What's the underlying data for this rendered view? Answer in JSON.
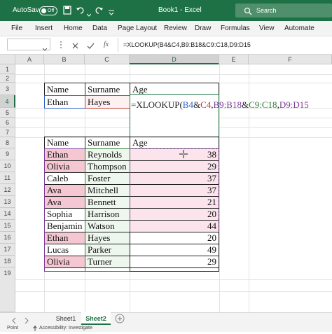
{
  "titlebar": {
    "autosave_label": "AutoSave",
    "autosave_state": "Off",
    "doc_title": "Book1 - Excel",
    "search_placeholder": "Search",
    "icons": [
      "save-icon",
      "undo-icon",
      "redo-icon",
      "customize-icon"
    ]
  },
  "ribbon": {
    "tabs": [
      "File",
      "Insert",
      "Home",
      "Data",
      "Page Layout",
      "Review",
      "Draw",
      "Formulas",
      "View",
      "Automate"
    ]
  },
  "formula_bar": {
    "name_box": "",
    "fx": "fx",
    "formula": "=XLOOKUP(B4&C4,B9:B18&C9:C18,D9:D15"
  },
  "grid": {
    "columns": [
      "A",
      "B",
      "C",
      "D",
      "E",
      "F"
    ],
    "rows": [
      "1",
      "2",
      "3",
      "4",
      "5",
      "6",
      "7",
      "8",
      "9",
      "10",
      "11",
      "12",
      "13",
      "14",
      "15",
      "16",
      "17",
      "18",
      "19"
    ]
  },
  "lookup_table": {
    "headers": [
      "Name",
      "Surname",
      "Age"
    ],
    "name": "Ethan",
    "surname": "Hayes",
    "formula_parts": [
      "=XLOOKUP(",
      "B4",
      "&",
      "C4",
      ",",
      "B9:B18",
      "&",
      "C9:C18",
      ",",
      "D9:",
      "D15"
    ]
  },
  "data_table": {
    "headers": [
      "Name",
      "Surname",
      "Age"
    ],
    "rows": [
      {
        "name": "Ethan",
        "surname": "Reynolds",
        "age": "38",
        "highlight": true
      },
      {
        "name": "Olivia",
        "surname": "Thompson",
        "age": "29",
        "highlight": true
      },
      {
        "name": "Caleb",
        "surname": "Foster",
        "age": "37",
        "highlight": false
      },
      {
        "name": "Ava",
        "surname": "Mitchell",
        "age": "37",
        "highlight": true
      },
      {
        "name": "Ava",
        "surname": "Bennett",
        "age": "21",
        "highlight": true
      },
      {
        "name": "Sophia",
        "surname": "Harrison",
        "age": "20",
        "highlight": false
      },
      {
        "name": "Benjamin",
        "surname": "Watson",
        "age": "44",
        "highlight": false
      },
      {
        "name": "Ethan",
        "surname": "Hayes",
        "age": "20",
        "highlight": true
      },
      {
        "name": "Lucas",
        "surname": "Parker",
        "age": "49",
        "highlight": false
      },
      {
        "name": "Olivia",
        "surname": "Turner",
        "age": "29",
        "highlight": true
      }
    ]
  },
  "sheets": {
    "tabs": [
      "Sheet1",
      "Sheet2"
    ],
    "active": "Sheet2"
  },
  "status": {
    "ready": "Point",
    "accessibility": "Accessibility: Investigate"
  },
  "colors": {
    "excel_green": "#1e7145",
    "name_highlight": "#f4c7d2",
    "surname_highlight": "#e6f3e6",
    "age_highlight": "#fbe4ec"
  }
}
